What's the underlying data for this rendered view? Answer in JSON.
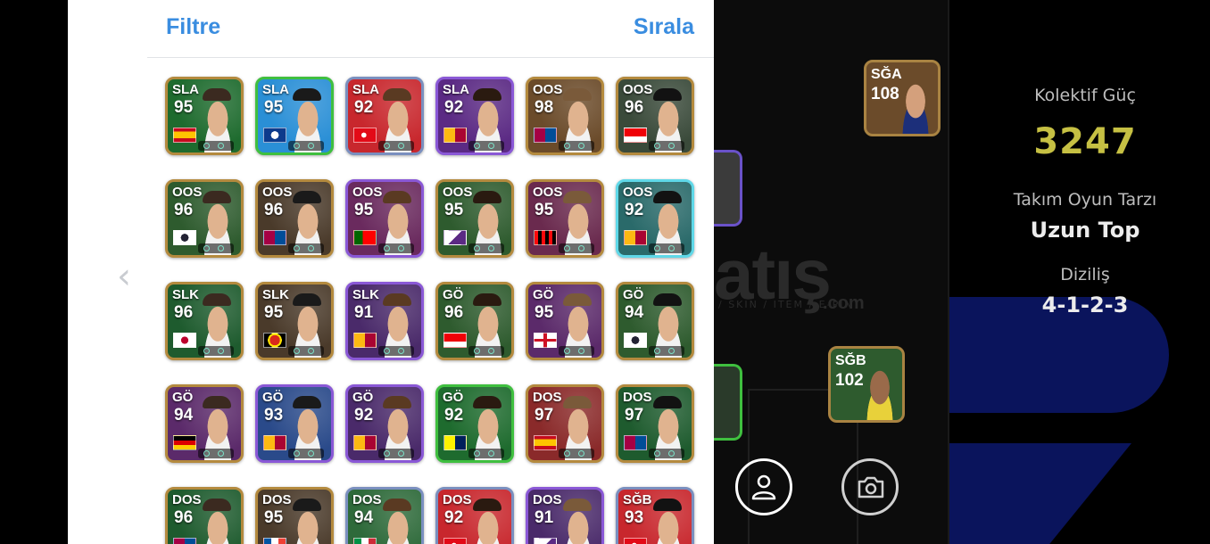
{
  "nav": {
    "back_icon": "chevron-left-icon"
  },
  "panel": {
    "filter_label": "Filtre",
    "sort_label": "Sırala"
  },
  "players": [
    {
      "pos": "SLA",
      "rating": "95",
      "flag": "spain",
      "theme": "#1e6b2e",
      "border": "#b48a3e"
    },
    {
      "pos": "SLA",
      "rating": "95",
      "flag": "club-blue",
      "theme": "#2a8fd6",
      "border": "#3fbf3f"
    },
    {
      "pos": "SLA",
      "rating": "92",
      "flag": "turkey",
      "theme": "#c8272d",
      "border": "#7a8fbf"
    },
    {
      "pos": "SLA",
      "rating": "92",
      "flag": "galatasaray",
      "theme": "#5b2a84",
      "border": "#8a58d6"
    },
    {
      "pos": "OOS",
      "rating": "98",
      "flag": "barcelona",
      "theme": "#6b4b2a",
      "border": "#b48a3e"
    },
    {
      "pos": "OOS",
      "rating": "96",
      "flag": "arsenal",
      "theme": "#3a4a3a",
      "border": "#b48a3e"
    },
    {
      "pos": "OOS",
      "rating": "96",
      "flag": "club-white",
      "theme": "#2e5b2e",
      "border": "#b48a3e"
    },
    {
      "pos": "OOS",
      "rating": "96",
      "flag": "barcelona",
      "theme": "#4a3a2a",
      "border": "#b48a3e"
    },
    {
      "pos": "OOS",
      "rating": "95",
      "flag": "portugal",
      "theme": "#6a2a5e",
      "border": "#8a58d6"
    },
    {
      "pos": "OOS",
      "rating": "95",
      "flag": "club-purple",
      "theme": "#2e5b2e",
      "border": "#b48a3e"
    },
    {
      "pos": "OOS",
      "rating": "95",
      "flag": "milan",
      "theme": "#6a2a4e",
      "border": "#b48a3e"
    },
    {
      "pos": "OOS",
      "rating": "92",
      "flag": "galatasaray",
      "theme": "#2a6a6a",
      "border": "#5fd8e8"
    },
    {
      "pos": "SLK",
      "rating": "96",
      "flag": "japan",
      "theme": "#1e5b2e",
      "border": "#b48a3e"
    },
    {
      "pos": "SLK",
      "rating": "95",
      "flag": "man-utd",
      "theme": "#4a3a2a",
      "border": "#b48a3e"
    },
    {
      "pos": "SLK",
      "rating": "91",
      "flag": "galatasaray",
      "theme": "#4a2a6a",
      "border": "#8a58d6"
    },
    {
      "pos": "GÖ",
      "rating": "96",
      "flag": "arsenal",
      "theme": "#2e5b2e",
      "border": "#b48a3e"
    },
    {
      "pos": "GÖ",
      "rating": "95",
      "flag": "england",
      "theme": "#5b2a6a",
      "border": "#b48a3e"
    },
    {
      "pos": "GÖ",
      "rating": "94",
      "flag": "club-white",
      "theme": "#2e5b2e",
      "border": "#b48a3e"
    },
    {
      "pos": "GÖ",
      "rating": "94",
      "flag": "germany",
      "theme": "#5b2a6a",
      "border": "#b48a3e"
    },
    {
      "pos": "GÖ",
      "rating": "93",
      "flag": "galatasaray",
      "theme": "#2a4a8a",
      "border": "#8a58d6"
    },
    {
      "pos": "GÖ",
      "rating": "92",
      "flag": "galatasaray",
      "theme": "#4a2a6a",
      "border": "#8a58d6"
    },
    {
      "pos": "GÖ",
      "rating": "92",
      "flag": "fenerbahce",
      "theme": "#1e6b2e",
      "border": "#3fbf3f"
    },
    {
      "pos": "DOS",
      "rating": "97",
      "flag": "spain",
      "theme": "#8a2a2a",
      "border": "#b48a3e"
    },
    {
      "pos": "DOS",
      "rating": "97",
      "flag": "barcelona",
      "theme": "#1e5b2e",
      "border": "#b48a3e"
    },
    {
      "pos": "DOS",
      "rating": "96",
      "flag": "barcelona",
      "theme": "#1e5b2e",
      "border": "#b48a3e"
    },
    {
      "pos": "DOS",
      "rating": "95",
      "flag": "france",
      "theme": "#4a3a2a",
      "border": "#b48a3e"
    },
    {
      "pos": "DOS",
      "rating": "94",
      "flag": "italy",
      "theme": "#2e6a3a",
      "border": "#7a8fbf"
    },
    {
      "pos": "DOS",
      "rating": "92",
      "flag": "turkey",
      "theme": "#c8272d",
      "border": "#7a8fbf"
    },
    {
      "pos": "DOS",
      "rating": "91",
      "flag": "club-purple",
      "theme": "#4a2a6a",
      "border": "#8a58d6"
    },
    {
      "pos": "SĞB",
      "rating": "93",
      "flag": "turkey",
      "theme": "#c8272d",
      "border": "#7a8fbf"
    }
  ],
  "pitch": {
    "watermark": "atış",
    "watermark_sub": "/ SKIN / ITEM / E-PIN",
    "watermark_com": ".com",
    "card_top": {
      "pos": "SĞA",
      "rating": "108"
    },
    "card_bottom": {
      "pos": "SĞB",
      "rating": "102"
    },
    "profile_icon": "user-icon",
    "camera_icon": "camera-icon"
  },
  "stats": {
    "power_label": "Kolektif Güç",
    "power_value": "3247",
    "style_label": "Takım Oyun Tarzı",
    "style_value": "Uzun Top",
    "formation_label": "Diziliş",
    "formation_value": "4-1-2-3"
  }
}
